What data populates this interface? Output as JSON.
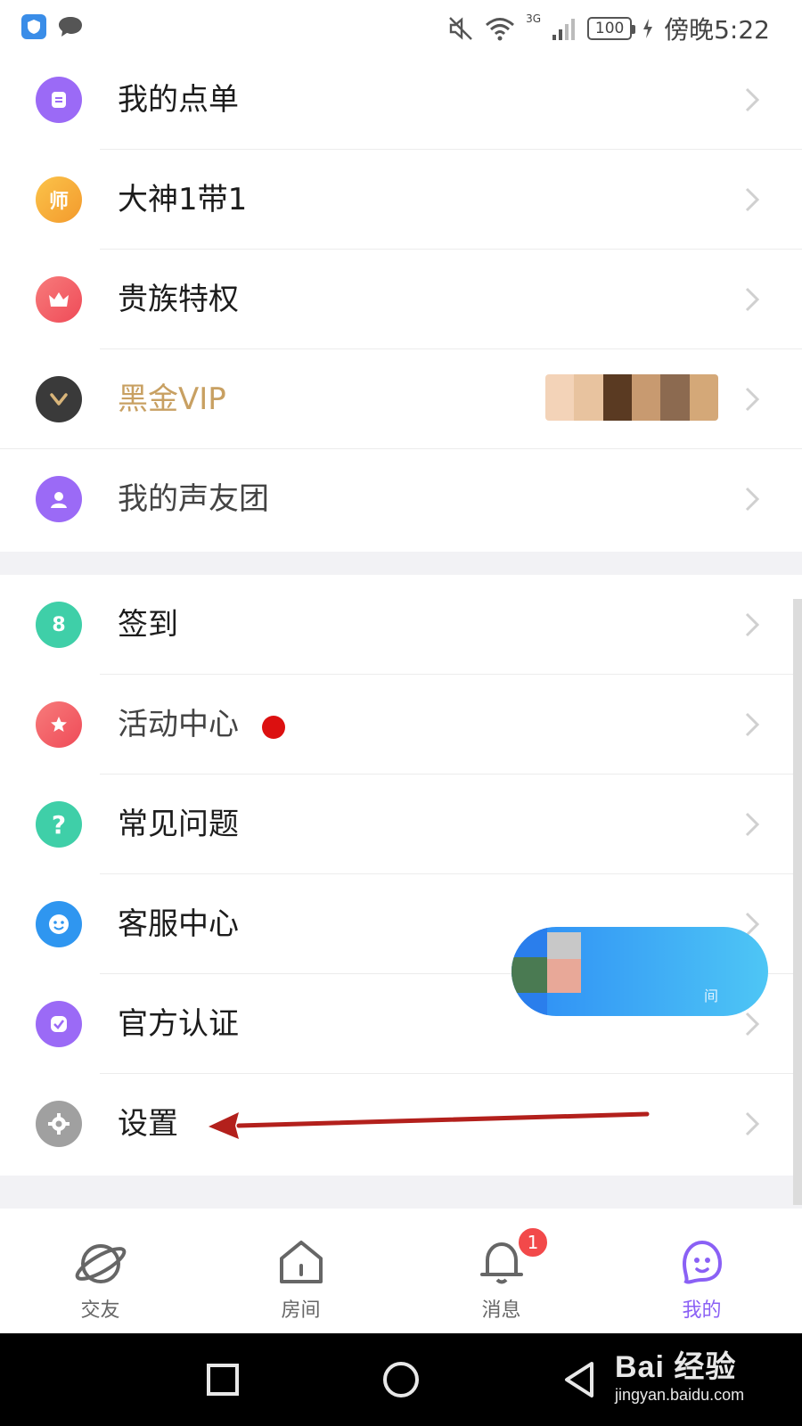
{
  "status_bar": {
    "battery": "100",
    "network": "3G",
    "time": "傍晚5:22"
  },
  "menu_group_1": [
    {
      "label": "我的点单",
      "icon": "order-icon",
      "color": "#9b6af6",
      "style": "normal"
    },
    {
      "label": "大神1带1",
      "icon": "master-icon",
      "glyph": "师",
      "color": "#f7a53a",
      "style": "normal"
    },
    {
      "label": "贵族特权",
      "icon": "crown-icon",
      "color": "#f2575e",
      "style": "normal"
    },
    {
      "label": "黑金VIP",
      "icon": "vip-icon",
      "color": "#3a3a3a",
      "style": "gold"
    },
    {
      "label": "我的声友团",
      "icon": "user-group-icon",
      "color": "#9b6af6",
      "style": "muted"
    }
  ],
  "menu_group_2": [
    {
      "label": "签到",
      "icon": "calendar-icon",
      "glyph": "8",
      "color": "#3fcfa8",
      "style": "normal"
    },
    {
      "label": "活动中心",
      "icon": "star-icon",
      "color": "#f2575e",
      "style": "muted",
      "has_dot": true
    },
    {
      "label": "常见问题",
      "icon": "question-icon",
      "glyph": "?",
      "color": "#3fcfa8",
      "style": "normal"
    },
    {
      "label": "客服中心",
      "icon": "service-icon",
      "color": "#2f96f0",
      "style": "normal"
    },
    {
      "label": "官方认证",
      "icon": "verified-icon",
      "color": "#9b6af6",
      "style": "normal"
    },
    {
      "label": "设置",
      "icon": "gear-icon",
      "color": "#9a9a9a",
      "style": "normal"
    }
  ],
  "floating_pill_text": "间",
  "tabs": [
    {
      "label": "交友",
      "icon": "planet-icon",
      "active": false
    },
    {
      "label": "房间",
      "icon": "house-icon",
      "active": false
    },
    {
      "label": "消息",
      "icon": "bell-icon",
      "active": false,
      "badge": "1"
    },
    {
      "label": "我的",
      "icon": "mascot-icon",
      "active": true
    }
  ],
  "watermark": {
    "logo": "Bai 经验",
    "url": "jingyan.baidu.com"
  },
  "colors": {
    "accent": "#8a60f5",
    "gold": "#c8a062",
    "badge": "#f2494a",
    "annotation_arrow": "#b3201c"
  }
}
